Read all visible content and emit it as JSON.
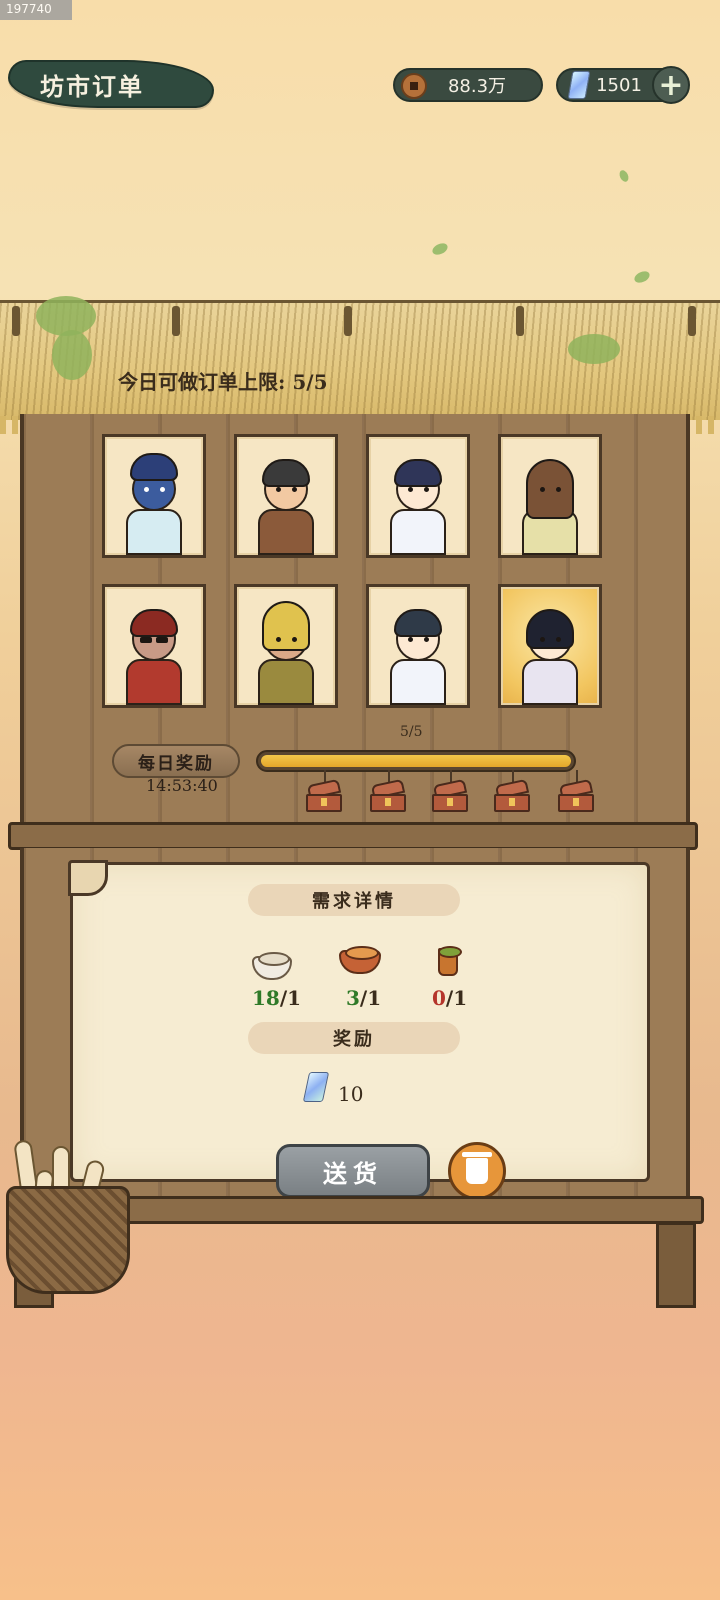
{
  "corner_id": "197740",
  "header": {
    "title": "坊市订单",
    "coins": "88.3万",
    "gems": "1501",
    "add_label": "+"
  },
  "shop": {
    "orders_limit_label": "今日可做订单上限: 5/5",
    "customers": [
      {
        "id": "dragon-customer",
        "active": false
      },
      {
        "id": "farmer-customer",
        "active": false
      },
      {
        "id": "swordsman-customer",
        "active": false
      },
      {
        "id": "maiden-customer",
        "active": false
      },
      {
        "id": "mouse-customer",
        "active": false
      },
      {
        "id": "hooded-customer",
        "active": false
      },
      {
        "id": "girl-customer",
        "active": false
      },
      {
        "id": "scholar-customer",
        "active": true
      }
    ]
  },
  "daily_reward": {
    "label": "每日奖励",
    "timer": "14:53:40",
    "progress_text": "5/5",
    "progress_fraction": 1.0,
    "chest_count": 5
  },
  "order": {
    "demand_title": "需求详情",
    "requirements": [
      {
        "icon": "rice-bowl-icon",
        "have": "18",
        "need": "/1",
        "sufficient": true
      },
      {
        "icon": "stew-pot-icon",
        "have": "3",
        "need": "/1",
        "sufficient": true
      },
      {
        "icon": "tea-cup-icon",
        "have": "0",
        "need": "/1",
        "sufficient": false
      }
    ],
    "reward_title": "奖励",
    "reward_icon": "spirit-gem-icon",
    "reward_value": "10"
  },
  "actions": {
    "deliver_label": "送货",
    "discard_icon": "trash-icon"
  }
}
